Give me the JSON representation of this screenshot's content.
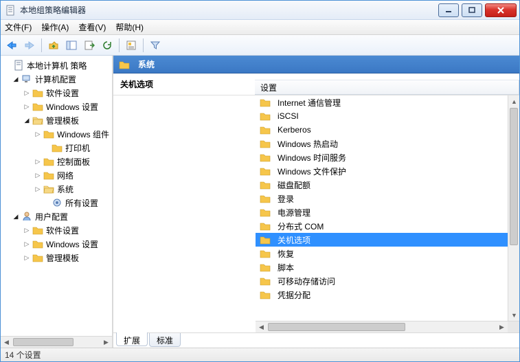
{
  "window": {
    "title": "本地组策略编辑器"
  },
  "menu": {
    "file": "文件(F)",
    "action": "操作(A)",
    "view": "查看(V)",
    "help": "帮助(H)"
  },
  "tree": {
    "root": "本地计算机 策略",
    "computer_config": "计算机配置",
    "software_settings": "软件设置",
    "windows_settings": "Windows 设置",
    "admin_templates": "管理模板",
    "windows_components": "Windows 组件",
    "printers": "打印机",
    "control_panel": "控制面板",
    "network": "网络",
    "system": "系统",
    "all_settings": "所有设置",
    "user_config": "用户配置",
    "software_settings2": "软件设置",
    "windows_settings2": "Windows 设置",
    "admin_templates2": "管理模板"
  },
  "detail": {
    "header": "系统",
    "selection_title": "关机选项",
    "column_header": "设置",
    "items": [
      "Internet 通信管理",
      "iSCSI",
      "Kerberos",
      "Windows 热启动",
      "Windows 时间服务",
      "Windows 文件保护",
      "磁盘配额",
      "登录",
      "电源管理",
      "分布式 COM",
      "关机选项",
      "恢复",
      "脚本",
      "可移动存储访问",
      "凭据分配"
    ],
    "selected_index": 10
  },
  "tabs": {
    "extended": "扩展",
    "standard": "标准"
  },
  "status": {
    "text": "14 个设置"
  }
}
